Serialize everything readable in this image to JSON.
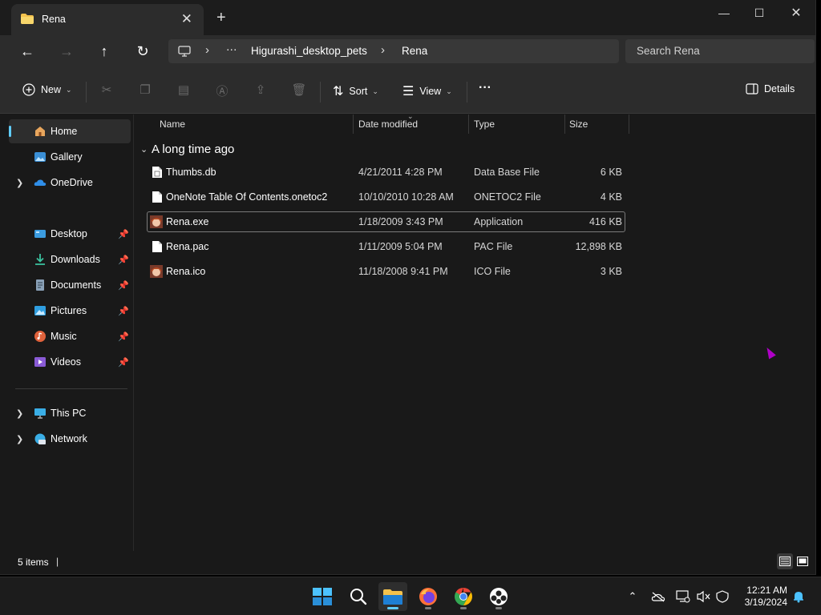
{
  "window": {
    "tab_title": "Rena",
    "tab_close_glyph": "✕",
    "new_tab_glyph": "+",
    "controls": {
      "minimize": "—",
      "maximize": "☐",
      "close": "✕"
    }
  },
  "address": {
    "back": "←",
    "forward": "→",
    "up": "↑",
    "refresh": "↻",
    "overflow": "···",
    "crumbs": [
      "Higurashi_desktop_pets",
      "Rena"
    ],
    "separator": "›"
  },
  "search": {
    "placeholder": "Search Rena"
  },
  "toolbar": {
    "new_label": "New",
    "sort_label": "Sort",
    "view_label": "View",
    "more_label": "···",
    "details_label": "Details"
  },
  "sidebar": {
    "home": "Home",
    "gallery": "Gallery",
    "onedrive": "OneDrive",
    "pinned": [
      "Desktop",
      "Downloads",
      "Documents",
      "Pictures",
      "Music",
      "Videos"
    ],
    "this_pc": "This PC",
    "network": "Network"
  },
  "columns": {
    "name": "Name",
    "date": "Date modified",
    "type": "Type",
    "size": "Size"
  },
  "group": {
    "title": "A long time ago"
  },
  "files": [
    {
      "name": "Thumbs.db",
      "date": "4/21/2011 4:28 PM",
      "type": "Data Base File",
      "size": "6 KB",
      "icon": "database-file-icon"
    },
    {
      "name": "OneNote Table Of Contents.onetoc2",
      "date": "10/10/2010 10:28 AM",
      "type": "ONETOC2 File",
      "size": "4 KB",
      "icon": "generic-file-icon"
    },
    {
      "name": "Rena.exe",
      "date": "1/18/2009 3:43 PM",
      "type": "Application",
      "size": "416 KB",
      "icon": "rena-app-icon"
    },
    {
      "name": "Rena.pac",
      "date": "1/11/2009 5:04 PM",
      "type": "PAC File",
      "size": "12,898 KB",
      "icon": "generic-file-icon"
    },
    {
      "name": "Rena.ico",
      "date": "11/18/2008 9:41 PM",
      "type": "ICO File",
      "size": "3 KB",
      "icon": "rena-app-icon"
    }
  ],
  "status": {
    "items": "5 items",
    "pipe": "|"
  },
  "taskbar": {
    "time": "12:21 AM",
    "date": "3/19/2024",
    "apps": [
      "start-icon",
      "search-icon",
      "file-explorer-icon",
      "firefox-icon",
      "chrome-icon",
      "desktop-pet-app-icon"
    ]
  },
  "colors": {
    "accent": "#60cdff",
    "folder": "#f4c24d",
    "window_bg": "#191919",
    "chrome_bg": "#2c2c2c"
  }
}
